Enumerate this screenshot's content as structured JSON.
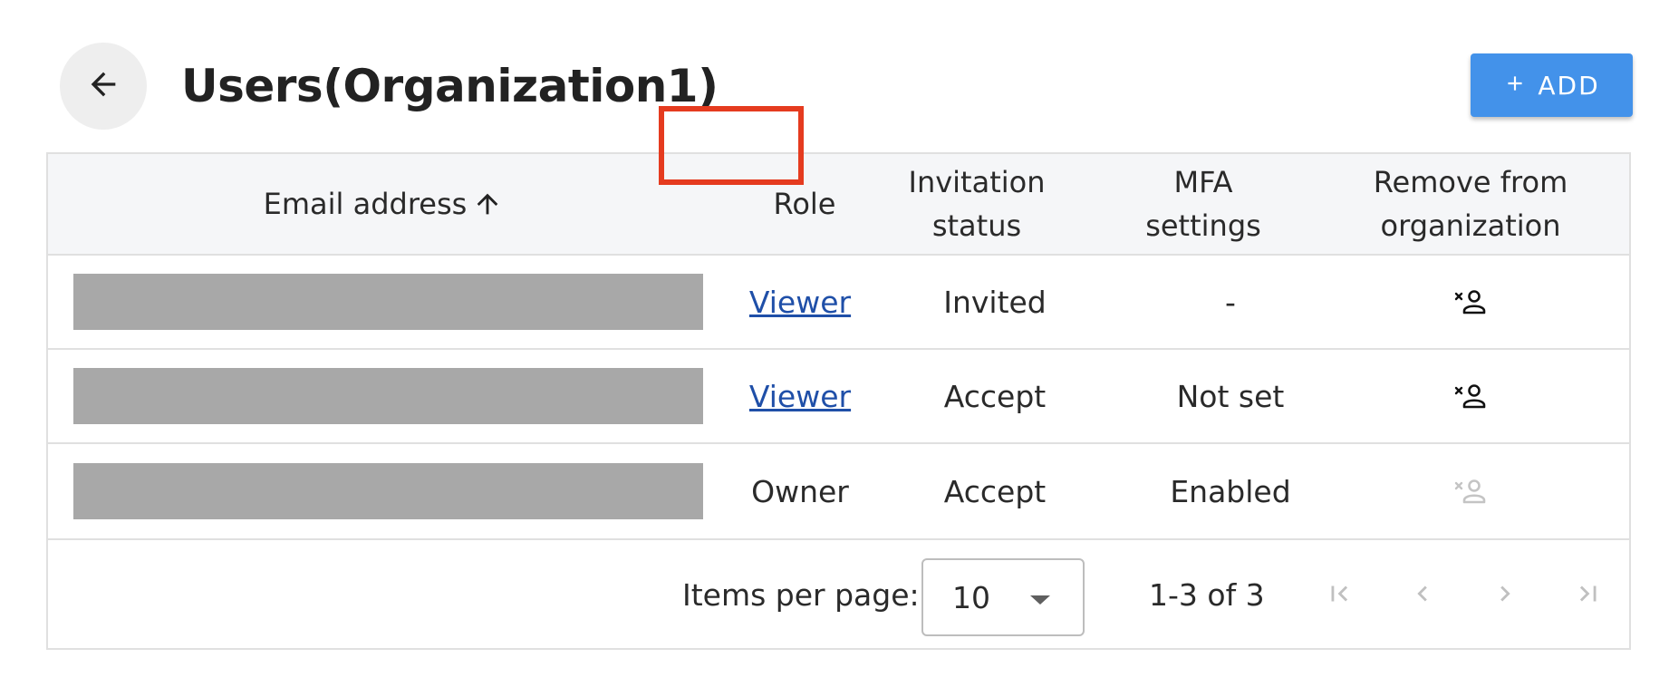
{
  "header": {
    "title": "Users(Organization1)",
    "back_icon": "arrow-left-icon",
    "add_label": "ADD",
    "add_icon": "plus-icon",
    "add_color": "#4392ea"
  },
  "table": {
    "columns": {
      "email": "Email address",
      "role": "Role",
      "invitation_status": "Invitation status",
      "mfa_settings": "MFA settings",
      "remove": "Remove from organization"
    },
    "sort": {
      "column": "email",
      "direction": "ascending",
      "icon": "arrow-up-icon"
    },
    "rows": [
      {
        "role": "Viewer",
        "role_is_link": true,
        "invitation_status": "Invited",
        "mfa": "-",
        "remove_enabled": true,
        "highlighted": true
      },
      {
        "role": "Viewer",
        "role_is_link": true,
        "invitation_status": "Accept",
        "mfa": "Not set",
        "remove_enabled": true,
        "highlighted": false
      },
      {
        "role": "Owner",
        "role_is_link": false,
        "invitation_status": "Accept",
        "mfa": "Enabled",
        "remove_enabled": false,
        "highlighted": false
      }
    ],
    "remove_icon": "remove-user-icon",
    "link_color": "#1f4fa8",
    "highlight_color": "#e53b1f"
  },
  "pagination": {
    "items_per_page_label": "Items per page:",
    "items_per_page": "10",
    "range": "1-3 of 3",
    "icons": [
      "first-page-icon",
      "previous-page-icon",
      "next-page-icon",
      "last-page-icon"
    ]
  }
}
